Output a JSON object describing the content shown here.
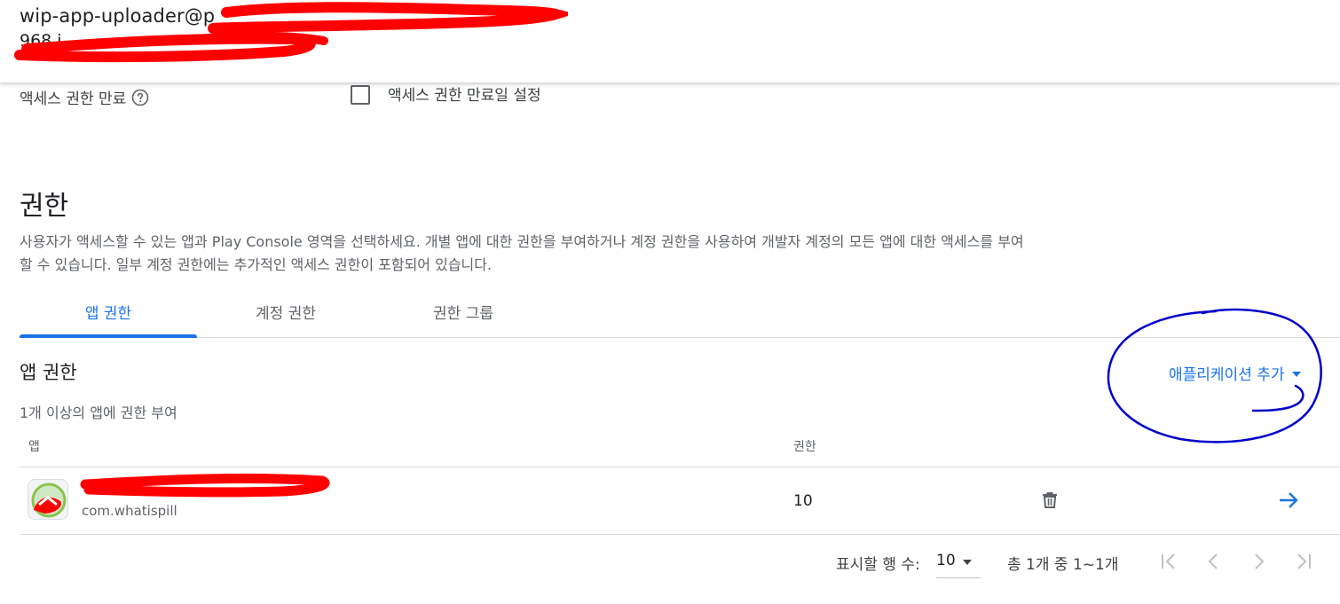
{
  "header": {
    "account_email": "wip-app-uploader@p",
    "account_sub": "968 i"
  },
  "access_expiry": {
    "label": "액세스 권한 만료",
    "help_icon": "help-circle-icon",
    "checkbox_label": "액세스 권한 만료일 설정",
    "checked": false
  },
  "permissions": {
    "title": "권한",
    "description": "사용자가 액세스할 수 있는 앱과 Play Console 영역을 선택하세요. 개별 앱에 대한 권한을 부여하거나 계정 권한을 사용하여 개발자 계정의 모든 앱에 대한 액세스를 부여할 수 있습니다. 일부 계정 권한에는 추가적인 액세스 권한이 포함되어 있습니다.",
    "tabs": [
      {
        "label": "앱 권한",
        "active": true
      },
      {
        "label": "계정 권한",
        "active": false
      },
      {
        "label": "권한 그룹",
        "active": false
      }
    ]
  },
  "app_permissions": {
    "title": "앱 권한",
    "description": "1개 이상의 앱에 권한 부여",
    "add_app_label": "애플리케이션 추가",
    "columns": {
      "app": "앱",
      "permissions": "권한"
    },
    "rows": [
      {
        "app_name": "",
        "package": "com.whatispill",
        "permission_count": "10",
        "delete_icon": "trash-icon",
        "open_icon": "arrow-right-icon"
      }
    ]
  },
  "pagination": {
    "rows_per_page_label": "표시할 행 수:",
    "rows_per_page_value": "10",
    "range_label": "총 1개 중 1~1개"
  },
  "colors": {
    "accent": "#1a73e8",
    "text_primary": "#202124",
    "text_secondary": "#5f6368",
    "divider": "#dadce0",
    "annotation_red": "#ff0000",
    "annotation_blue": "#0000cc"
  }
}
